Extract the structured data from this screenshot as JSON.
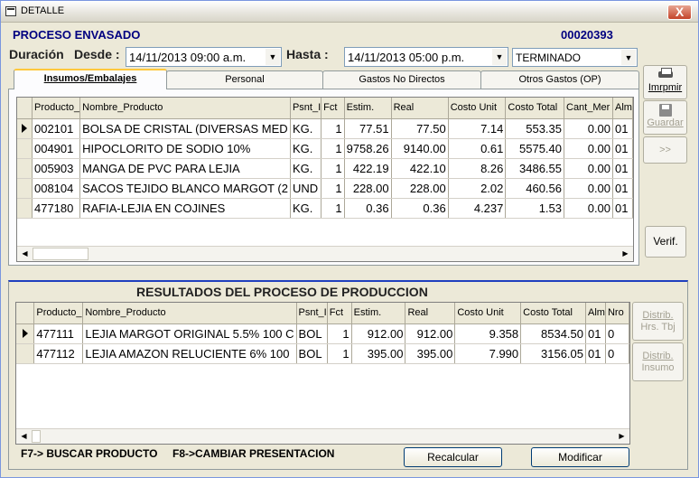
{
  "window": {
    "title": "DETALLE",
    "close_label": "X"
  },
  "header": {
    "process_label": "PROCESO ENVASADO",
    "process_number": "00020393",
    "duration_label": "Duración",
    "from_label": "Desde :",
    "from_value": "14/11/2013 09:00 a.m.",
    "to_label": "Hasta :",
    "to_value": "14/11/2013 05:00 p.m.",
    "status_value": "TERMINADO"
  },
  "tabs": [
    {
      "label": "Insumos/Embalajes",
      "active": true
    },
    {
      "label": "Personal"
    },
    {
      "label": "Gastos No Directos"
    },
    {
      "label": "Otros Gastos (OP)"
    }
  ],
  "inputs_grid": {
    "columns": [
      "Producto_",
      "Nombre_Producto",
      "Psnt_I",
      "Fct",
      "Estim.",
      "Real",
      "Costo Unit",
      "Costo Total",
      "Cant_Mer",
      "Alm"
    ],
    "rows": [
      [
        "002101",
        "BOLSA DE CRISTAL (DIVERSAS MED",
        "KG.",
        "1",
        "77.51",
        "77.50",
        "7.14",
        "553.35",
        "0.00",
        "01"
      ],
      [
        "004901",
        "HIPOCLORITO DE SODIO 10%",
        "KG.",
        "1",
        "9758.26",
        "9140.00",
        "0.61",
        "5575.40",
        "0.00",
        "01"
      ],
      [
        "005903",
        "MANGA DE PVC PARA LEJIA",
        "KG.",
        "1",
        "422.19",
        "422.10",
        "8.26",
        "3486.55",
        "0.00",
        "01"
      ],
      [
        "008104",
        "SACOS TEJIDO BLANCO MARGOT (2",
        "UND",
        "1",
        "228.00",
        "228.00",
        "2.02",
        "460.56",
        "0.00",
        "01"
      ],
      [
        "477180",
        "RAFIA-LEJIA EN COJINES",
        "KG.",
        "1",
        "0.36",
        "0.36",
        "4.237",
        "1.53",
        "0.00",
        "01"
      ]
    ]
  },
  "side_buttons": {
    "print_label": "Imrpmir",
    "save_label": "Guardar",
    "next_label": ">>",
    "verify_label": "Verif."
  },
  "results": {
    "title": "RESULTADOS DEL PROCESO DE PRODUCCION",
    "columns": [
      "Producto_",
      "Nombre_Producto",
      "Psnt_I",
      "Fct",
      "Estim.",
      "Real",
      "Costo Unit",
      "Costo Total",
      "Alm",
      "Nro"
    ],
    "rows": [
      [
        "477111",
        "LEJIA MARGOT ORIGINAL 5.5% 100 C",
        "BOL",
        "1",
        "912.00",
        "912.00",
        "9.358",
        "8534.50",
        "01",
        "0"
      ],
      [
        "477112",
        "LEJIA AMAZON RELUCIENTE 6% 100",
        "BOL",
        "1",
        "395.00",
        "395.00",
        "7.990",
        "3156.05",
        "01",
        "0"
      ]
    ],
    "distrib_hours_label_1": "Distrib.",
    "distrib_hours_label_2": "Hrs. Tbj",
    "distrib_input_label_1": "Distrib.",
    "distrib_input_label_2": "Insumo"
  },
  "footer": {
    "hint_search": "F7-> BUSCAR PRODUCTO",
    "hint_change": "F8->CAMBIAR PRESENTACION",
    "recalc_label": "Recalcular",
    "modify_label": "Modificar"
  }
}
